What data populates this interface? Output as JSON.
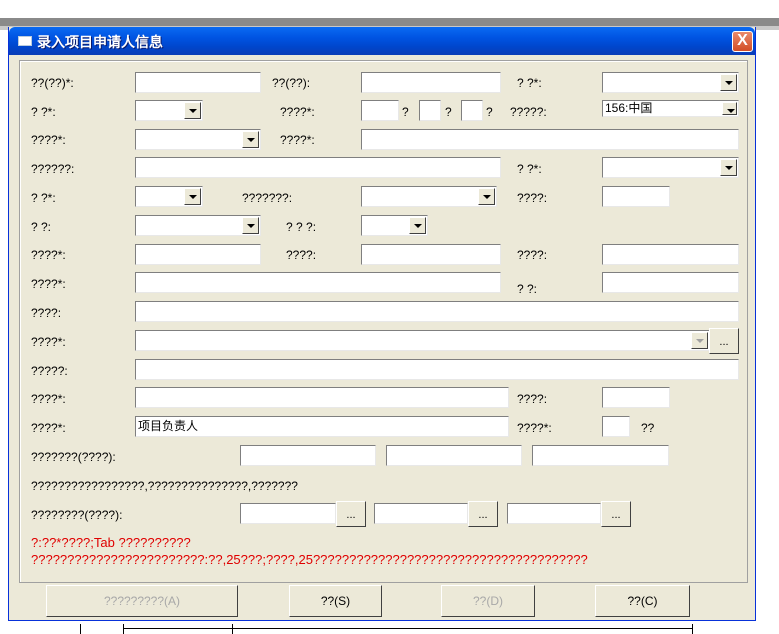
{
  "window": {
    "title": "录入项目申请人信息",
    "close_label": "X"
  },
  "form": {
    "row1": {
      "l1": "??(??)*:",
      "l2": "??(??):",
      "l3": "?   ?*:"
    },
    "row2": {
      "l1": "?   ?*:",
      "l2": "????*:",
      "sep1": "?",
      "sep2": "?",
      "sep3": "?",
      "l3": "?????:",
      "country_value": "156:中国"
    },
    "row3": {
      "l1": "????*:",
      "l2": "????*:"
    },
    "row4": {
      "l1": "??????:",
      "l2": "?   ?*:"
    },
    "row5": {
      "l1": "?   ?*:",
      "l2": "???????:",
      "l3": "????:"
    },
    "row6": {
      "l1": "?   ?:",
      "l2": "? ? ?:"
    },
    "row7": {
      "l1": "????*:",
      "l2": "????:",
      "l3": "????:"
    },
    "row8": {
      "l1": "????*:",
      "l2": "?   ?:"
    },
    "row9": {
      "l1": "????:"
    },
    "row10": {
      "l1": "????*:",
      "ellipsis": "..."
    },
    "row11": {
      "l1": "?????:"
    },
    "row12": {
      "l1": "????*:",
      "l2": "????:"
    },
    "row13": {
      "l1": "????*:",
      "role_value": "项目负责人",
      "l2": "????*:",
      "suffix": "??"
    },
    "row14": {
      "l1": "???????(????):"
    },
    "row15": {
      "note": "?????????????????,???????????????,???????"
    },
    "row16": {
      "l1": "????????(????):",
      "ellipsis": "..."
    },
    "hint1": "?:??*????;Tab ??????????",
    "hint2": "????????????????????????:??,25???;????,25??????????????????????????????????????"
  },
  "buttons": {
    "b1": "?????????(A)",
    "b2": "??(S)",
    "b3": "??(D)",
    "b4": "??(C)"
  }
}
